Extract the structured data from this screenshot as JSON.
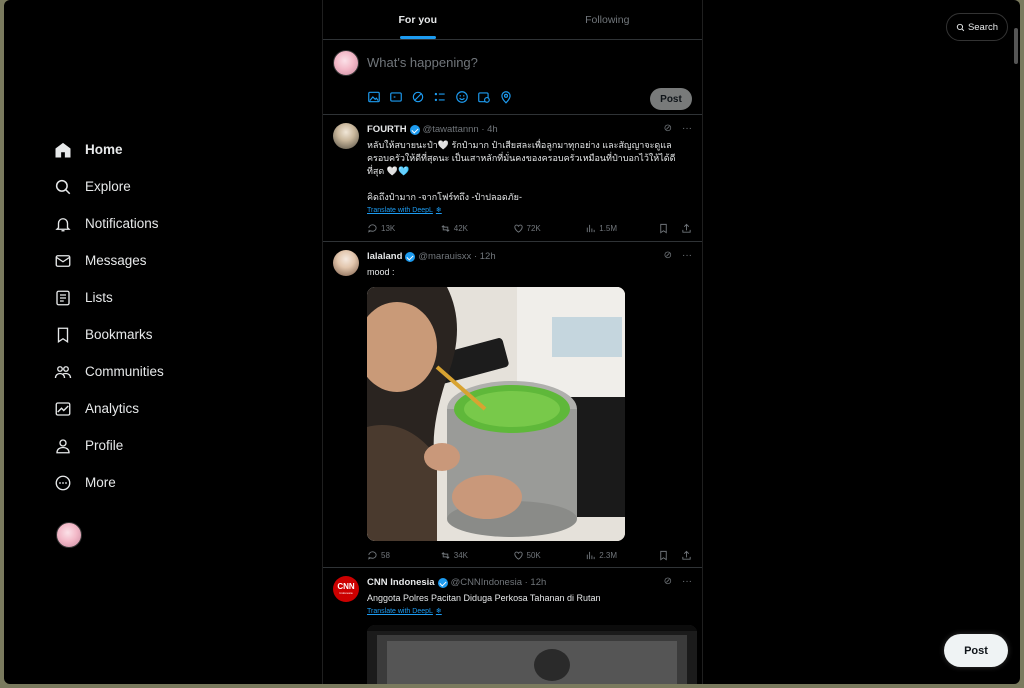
{
  "nav": {
    "home": "Home",
    "explore": "Explore",
    "notifications": "Notifications",
    "messages": "Messages",
    "lists": "Lists",
    "bookmarks": "Bookmarks",
    "communities": "Communities",
    "analytics": "Analytics",
    "profile": "Profile",
    "more": "More"
  },
  "tabs": {
    "for_you": "For you",
    "following": "Following"
  },
  "composer": {
    "placeholder": "What's happening?",
    "post_label": "Post"
  },
  "search": {
    "label": "Search"
  },
  "floating_post": "Post",
  "tweets": [
    {
      "name": "FOURTH",
      "handle": "@tawattannn · 4h",
      "text": "หลับให้สบายนะป๋า🤍 รักป๋ามาก ป๋าเสียสละเพื่อลูกมาทุกอย่าง และสัญญาจะดูแลครอบครัวให้ดีที่สุดนะ เป็นเสาหลักที่มั่นคงของครอบครัวเหมือนที่ป๋าบอกไว้ให้ได้ดีที่สุด 🤍🩵\n\nคิดถึงป๋ามาก -จากโฟร์ทถึง -ป๋าปลอดภัย-",
      "translate": "Translate with DeepL",
      "replies": "13K",
      "reposts": "42K",
      "likes": "72K",
      "views": "1.5M"
    },
    {
      "name": "lalaland",
      "handle": "@marauisxx · 12h",
      "text": "mood :",
      "replies": "58",
      "reposts": "34K",
      "likes": "50K",
      "views": "2.3M"
    },
    {
      "name": "CNN Indonesia",
      "handle": "@CNNIndonesia · 12h",
      "avatar_text": "CNN",
      "avatar_sub": "Indonesia",
      "text": "Anggota Polres Pacitan Diduga Perkosa Tahanan di Rutan",
      "translate": "Translate with DeepL"
    }
  ],
  "colors": {
    "accent": "#1d9bf0",
    "background": "#000000",
    "muted": "#71767b"
  }
}
